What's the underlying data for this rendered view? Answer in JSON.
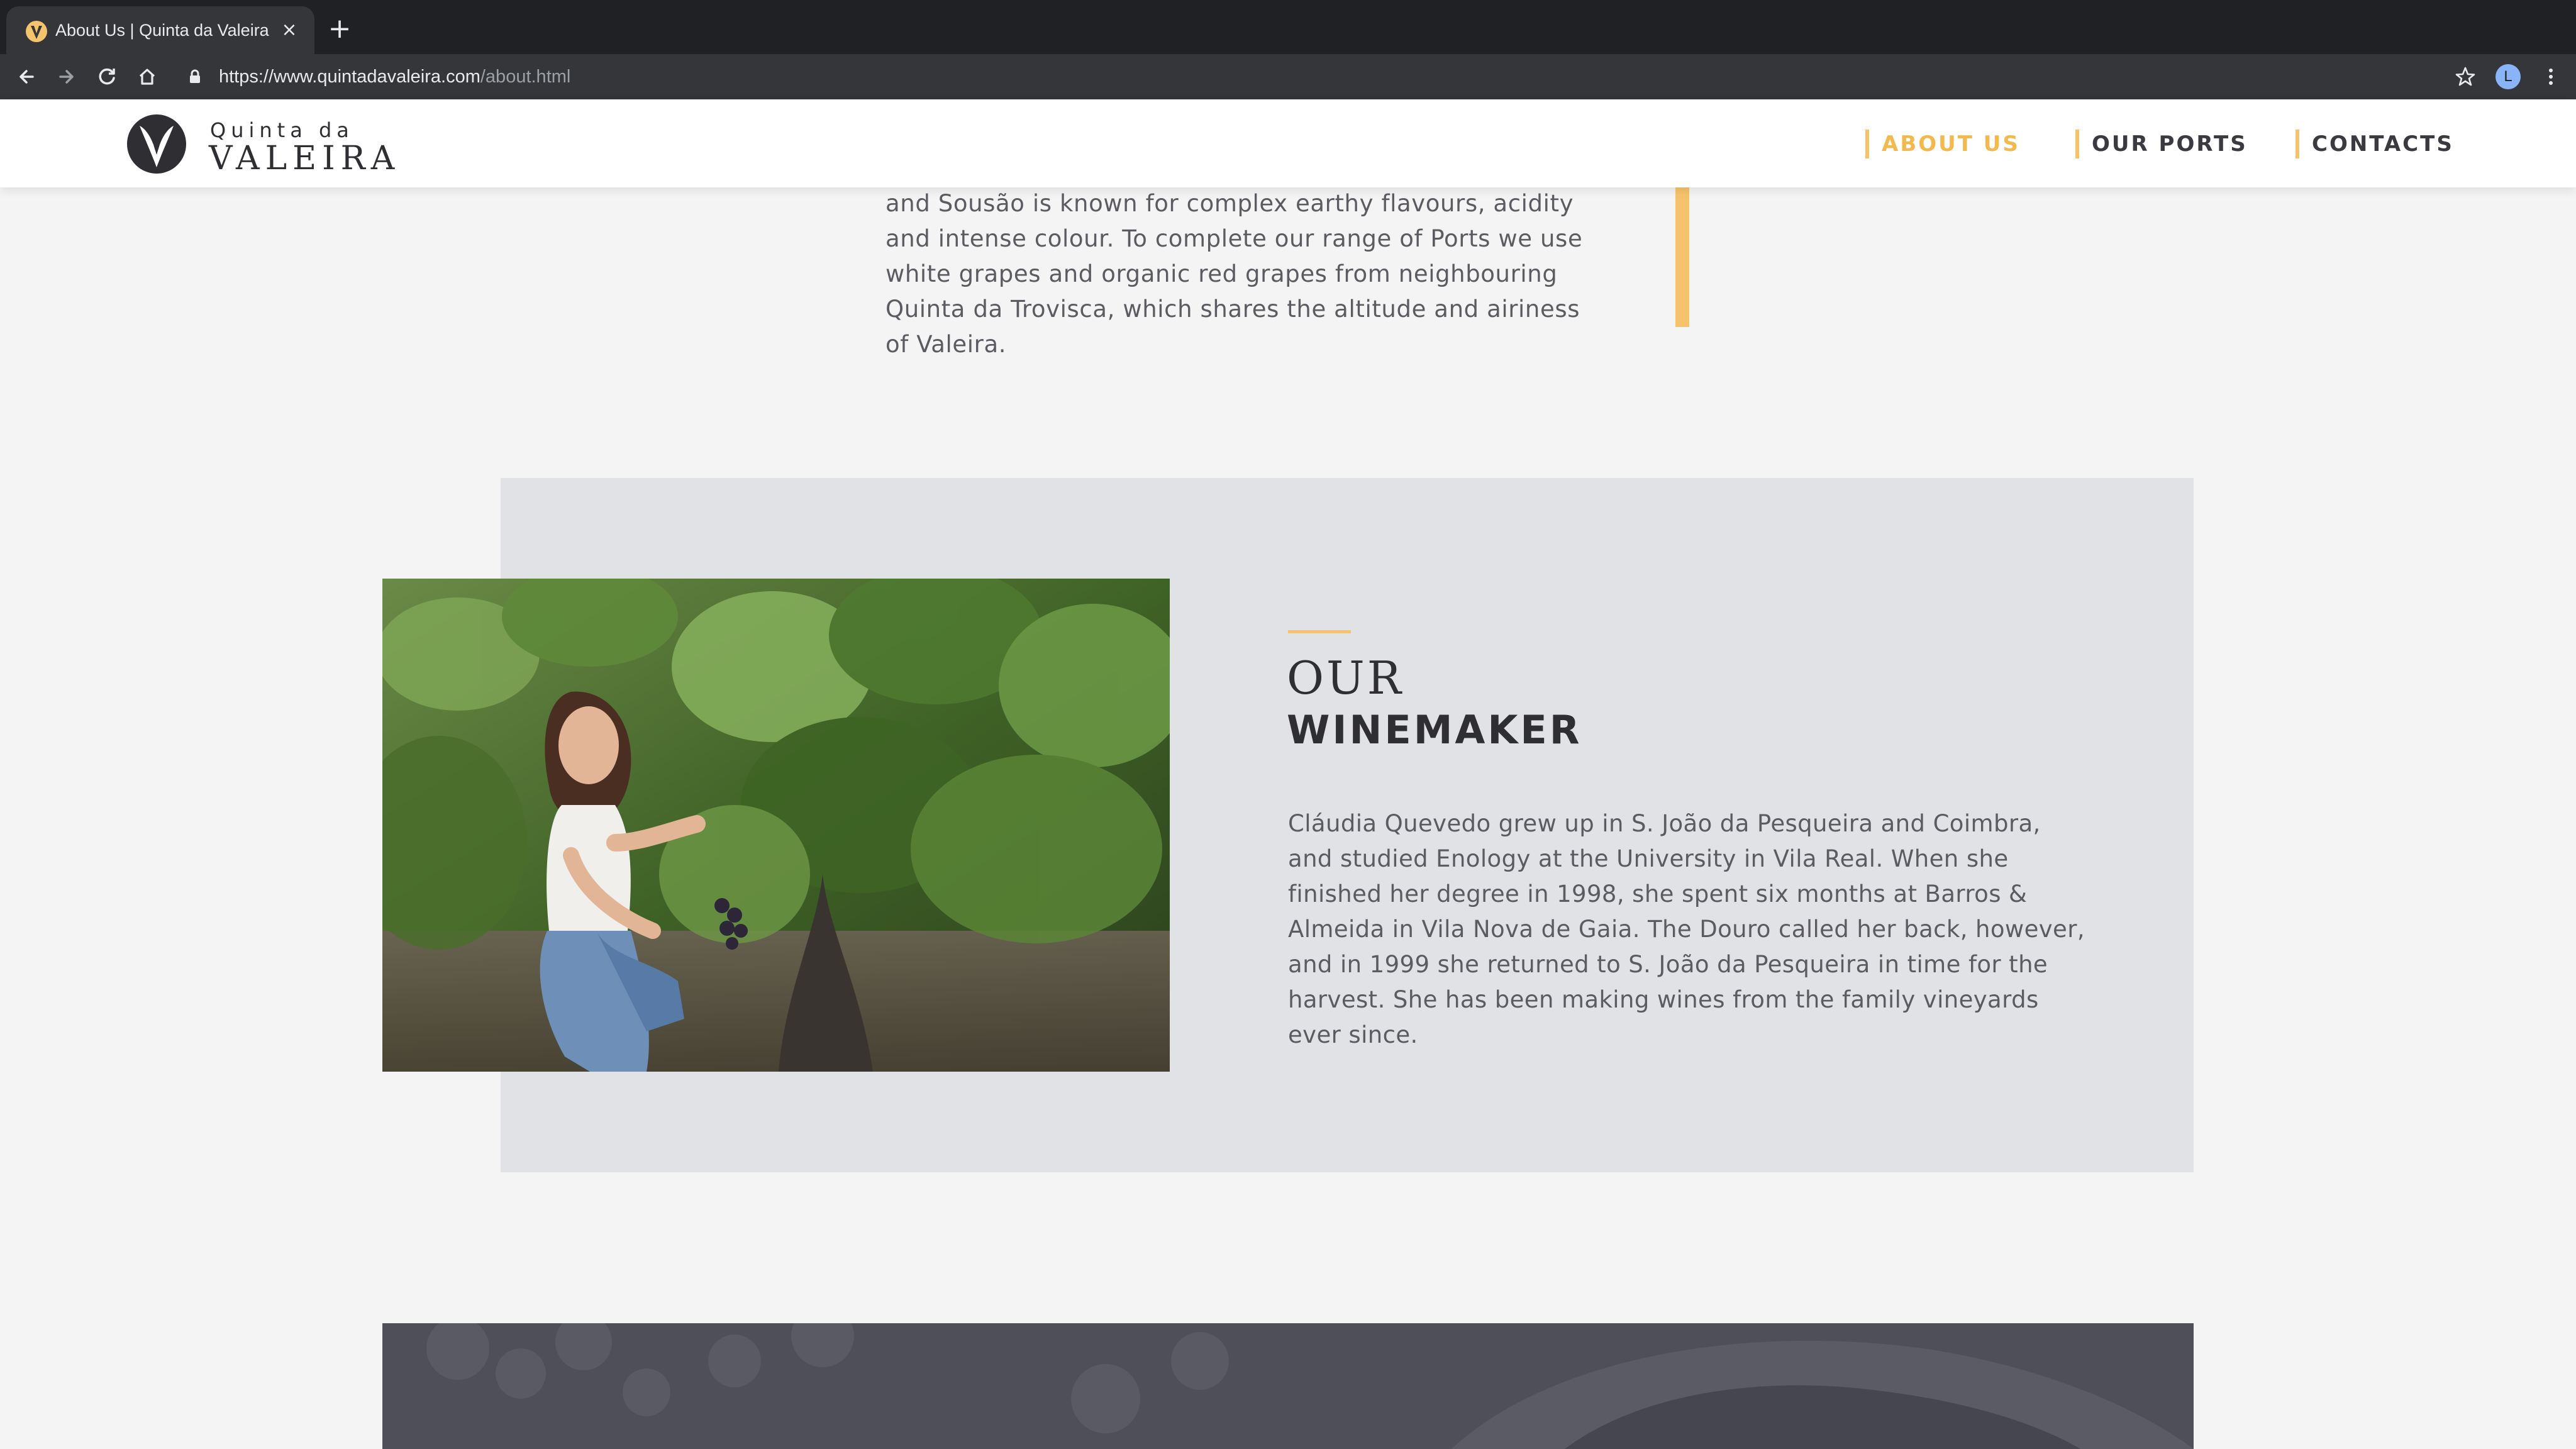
{
  "browser": {
    "tab_title": "About Us | Quinta da Valeira",
    "url_host": "https://www.quintadavaleira.com",
    "url_path": "/about.html",
    "profile_initial": "L",
    "icons": [
      "back-icon",
      "forward-icon",
      "reload-icon",
      "home-icon",
      "lock-icon",
      "star-icon",
      "menu-icon",
      "close-icon",
      "plus-icon"
    ]
  },
  "site": {
    "logo_top": "Quinta da",
    "logo_bottom": "VALEIRA",
    "nav": [
      {
        "label": "ABOUT US",
        "active": true
      },
      {
        "label": "OUR PORTS",
        "active": false
      },
      {
        "label": "CONTACTS",
        "active": false
      }
    ],
    "accent_color": "#f5c36b"
  },
  "intro": {
    "text": "and Sousão is known for complex earthy flavours, acidity and intense colour. To complete our range of Ports we use white grapes and organic red grapes from neighbouring Quinta da Trovisca, which shares the altitude and airiness of Valeira."
  },
  "winemaker": {
    "title_line1": "OUR",
    "title_line2": "WINEMAKER",
    "bio": "Cláudia Quevedo grew up in S. João da Pesqueira and Coimbra, and studied Enology at the University in Vila Real. When she finished her degree in 1998, she spent six months at Barros & Almeida in Vila Nova de Gaia. The Douro called her back, however, and in 1999 she returned to S. João da Pesqueira in time for the harvest. She has been making wines from the family vineyards ever since."
  }
}
